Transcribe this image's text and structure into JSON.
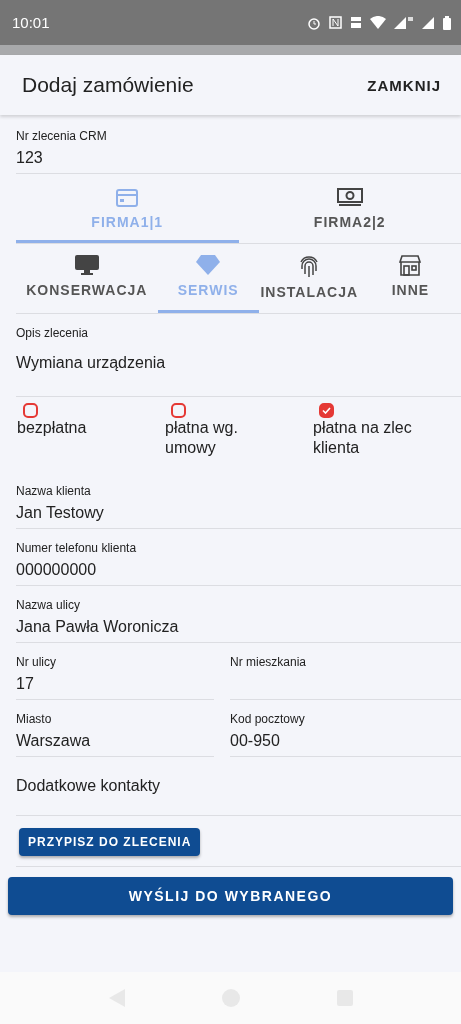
{
  "status_bar": {
    "time": "10:01"
  },
  "app_bar": {
    "title": "Dodaj zamówienie",
    "action": "ZAMKNIJ"
  },
  "crm_field": {
    "label": "Nr zlecenia CRM",
    "value": "123"
  },
  "company_tabs": [
    {
      "label": "FIRMA1|1",
      "selected": true
    },
    {
      "label": "FIRMA2|2",
      "selected": false
    }
  ],
  "category_tabs": [
    {
      "label": "KONSERWACJA",
      "selected": false
    },
    {
      "label": "SERWIS",
      "selected": true
    },
    {
      "label": "INSTALACJA",
      "selected": false
    },
    {
      "label": "INNE",
      "selected": false
    }
  ],
  "description": {
    "label": "Opis zlecenia",
    "value": "Wymiana urządzenia"
  },
  "payment_options": [
    {
      "label": "bezpłatna",
      "checked": false
    },
    {
      "label": "płatna wg. umowy",
      "checked": false
    },
    {
      "label": "płatna na zlec klienta",
      "checked": true
    }
  ],
  "field_rows": [
    [
      {
        "label": "Nazwa klienta",
        "value": "Jan Testowy"
      }
    ],
    [
      {
        "label": "Numer telefonu klienta",
        "value": "000000000"
      }
    ],
    [
      {
        "label": "Nazwa ulicy",
        "value": "Jana Pawła Woronicza"
      }
    ],
    [
      {
        "label": "Nr ulicy",
        "value": "17"
      },
      {
        "label": "Nr mieszkania"
      }
    ],
    [
      {
        "label": "Miasto",
        "value": "Warszawa"
      },
      {
        "label": "Kod pocztowy",
        "value": "00-950"
      }
    ]
  ],
  "extra_contacts": {
    "label": "Dodatkowe kontakty"
  },
  "assign_button": "PRZYPISZ DO ZLECENIA",
  "send_button": "WYŚLIJ DO WYBRANEGO"
}
